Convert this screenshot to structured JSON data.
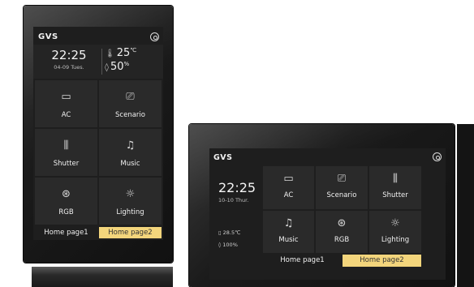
{
  "device1": {
    "brand": "GVS",
    "time": "22:25",
    "date": "04-09 Tues.",
    "temperature": "25",
    "temperature_unit": "℃",
    "humidity": "50",
    "humidity_unit": "%",
    "tiles": [
      {
        "label": "AC",
        "icon": "ac-icon"
      },
      {
        "label": "Scenario",
        "icon": "scenario-icon"
      },
      {
        "label": "Shutter",
        "icon": "shutter-icon"
      },
      {
        "label": "Music",
        "icon": "music-icon"
      },
      {
        "label": "RGB",
        "icon": "rgb-icon"
      },
      {
        "label": "Lighting",
        "icon": "lighting-icon"
      }
    ],
    "tabs": [
      {
        "label": "Home page1",
        "active": false
      },
      {
        "label": "Home page2",
        "active": true
      }
    ]
  },
  "device2": {
    "brand": "GVS",
    "time": "22:25",
    "date": "10-10 Thur.",
    "temperature": "28.5℃",
    "humidity": "100%",
    "tiles": [
      {
        "label": "AC",
        "icon": "ac-icon"
      },
      {
        "label": "Scenario",
        "icon": "scenario-icon"
      },
      {
        "label": "Shutter",
        "icon": "shutter-icon"
      },
      {
        "label": "Music",
        "icon": "music-icon"
      },
      {
        "label": "RGB",
        "icon": "rgb-icon"
      },
      {
        "label": "Lighting",
        "icon": "lighting-icon"
      }
    ],
    "tabs": [
      {
        "label": "Home page1",
        "active": false
      },
      {
        "label": "Home page2",
        "active": true
      }
    ]
  },
  "colors": {
    "screen_bg": "#1e1e1e",
    "tile_bg": "#2a2a2a",
    "active_tab": "#f3d57c",
    "text": "#f0f0f0"
  }
}
